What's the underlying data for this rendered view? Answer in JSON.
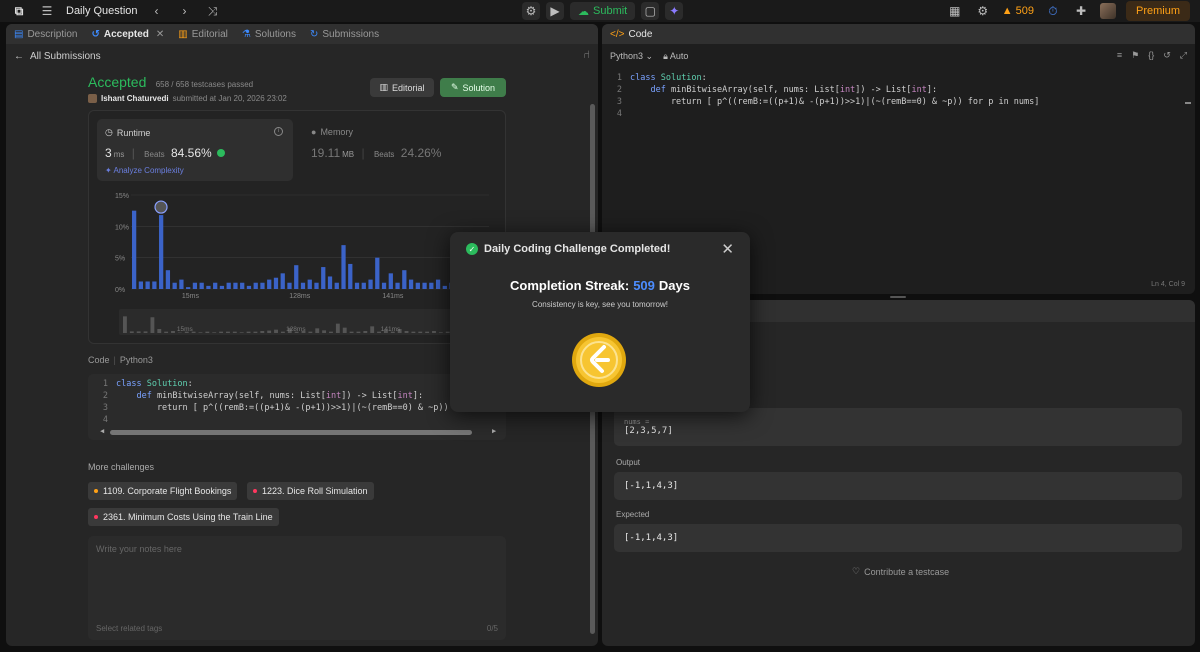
{
  "topbar": {
    "title": "Daily Question",
    "submit_label": "Submit",
    "streak_count": "509",
    "premium_label": "Premium"
  },
  "left_tabs": [
    {
      "label": "Description",
      "active": false
    },
    {
      "label": "Accepted",
      "active": true
    },
    {
      "label": "Editorial",
      "active": false
    },
    {
      "label": "Solutions",
      "active": false
    },
    {
      "label": "Submissions",
      "active": false
    }
  ],
  "submission": {
    "back_label": "All Submissions",
    "status": "Accepted",
    "testcases": "658 / 658 testcases passed",
    "user": "Ishant Chaturvedi",
    "submitted_text": "submitted at Jan 20, 2026 23:02",
    "editorial_btn": "Editorial",
    "solution_btn": "Solution"
  },
  "runtime": {
    "label": "Runtime",
    "value": "3",
    "unit": "ms",
    "beats_label": "Beats",
    "beats_value": "84.56%",
    "analyze": "Analyze Complexity"
  },
  "memory": {
    "label": "Memory",
    "value": "19.11",
    "unit": "MB",
    "beats_label": "Beats",
    "beats_value": "24.26%"
  },
  "chart_data": {
    "type": "bar",
    "y_ticks": [
      "15%",
      "10%",
      "5%",
      "0%"
    ],
    "ylim": [
      0,
      15
    ],
    "x_tick_labels": [
      "15ms",
      "128ms",
      "141ms",
      "157ms"
    ],
    "values": [
      12.5,
      1.2,
      1.2,
      1.2,
      11.8,
      3.0,
      1.0,
      1.5,
      0.3,
      1.0,
      1.0,
      0.5,
      1.0,
      0.5,
      1.0,
      1.0,
      1.0,
      0.5,
      1.0,
      1.0,
      1.5,
      1.8,
      2.5,
      1.0,
      3.8,
      1.0,
      1.5,
      1.0,
      3.5,
      2.0,
      1.0,
      7.0,
      4.0,
      1.0,
      1.0,
      1.5,
      5.0,
      1.0,
      2.5,
      1.0,
      3.0,
      1.5,
      1.0,
      1.0,
      1.0,
      1.5,
      0.5,
      1.0,
      1.0,
      1.0,
      1.0,
      0.5,
      0.5
    ]
  },
  "code_section": {
    "label": "Code",
    "lang": "Python3",
    "lines": [
      {
        "n": "1",
        "text": "class Solution:"
      },
      {
        "n": "2",
        "text": "    def minBitwiseArray(self, nums: List[int]) -> List[int]:"
      },
      {
        "n": "3",
        "text": "        return [ p^((remB:=((p+1)& -(p+1))>>1)|(~(remB==0) & ~p)) for p in nums]"
      },
      {
        "n": "4",
        "text": ""
      }
    ]
  },
  "more_challenges": {
    "title": "More challenges",
    "items": [
      {
        "label": "1109. Corporate Flight Bookings",
        "dot_color": "#ffa116"
      },
      {
        "label": "1223. Dice Roll Simulation",
        "dot_color": "#ff375f"
      },
      {
        "label": "2361. Minimum Costs Using the Train Line",
        "dot_color": "#ff375f"
      }
    ]
  },
  "notes": {
    "placeholder": "Write your notes here",
    "tags_placeholder": "Select related tags",
    "tags_count": "0/5"
  },
  "code_panel": {
    "tab_label": "Code",
    "lang": "Python3",
    "auto_label": "Auto",
    "status": "Ln 4, Col 9"
  },
  "test_panel": {
    "input_var": "nums =",
    "input_value": "[2,3,5,7]",
    "output_label": "Output",
    "output_value": "[-1,1,4,3]",
    "expected_label": "Expected",
    "expected_value": "[-1,1,4,3]",
    "contribute": "Contribute a testcase"
  },
  "modal": {
    "title": "Daily Coding Challenge Completed!",
    "streak_label": "Completion Streak:",
    "streak_value": "509",
    "streak_unit": "Days",
    "subtitle": "Consistency is key, see you tomorrow!"
  },
  "colors": {
    "accent": "#ffa116",
    "accepted": "#2cbb5d",
    "bar_blue": "#3b63c8",
    "streak_blue": "#4c8dff"
  }
}
